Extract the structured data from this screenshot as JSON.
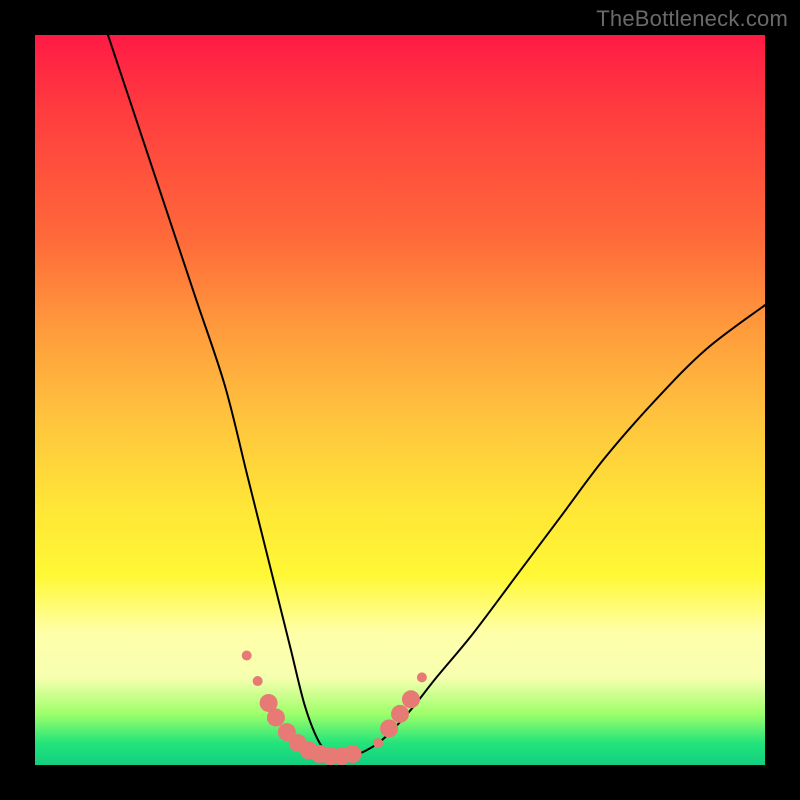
{
  "watermark": "TheBottleneck.com",
  "chart_data": {
    "type": "line",
    "title": "",
    "xlabel": "",
    "ylabel": "",
    "xlim": [
      0,
      100
    ],
    "ylim": [
      0,
      100
    ],
    "grid": false,
    "legend": false,
    "series": [
      {
        "name": "bottleneck-curve",
        "color": "#000000",
        "x": [
          10,
          14,
          18,
          22,
          26,
          29,
          31,
          33,
          35,
          37,
          39,
          41,
          43,
          47,
          51,
          55,
          60,
          66,
          72,
          78,
          85,
          92,
          100
        ],
        "y": [
          100,
          88,
          76,
          64,
          52,
          40,
          32,
          24,
          16,
          8,
          3,
          1,
          1,
          3,
          7,
          12,
          18,
          26,
          34,
          42,
          50,
          57,
          63
        ]
      }
    ],
    "markers": {
      "name": "highlight-dots",
      "color": "#e77a74",
      "radius_small": 5,
      "radius_large": 9,
      "points": [
        {
          "x": 29.0,
          "y": 15.0,
          "r": "small"
        },
        {
          "x": 30.5,
          "y": 11.5,
          "r": "small"
        },
        {
          "x": 32.0,
          "y": 8.5,
          "r": "large"
        },
        {
          "x": 33.0,
          "y": 6.5,
          "r": "large"
        },
        {
          "x": 34.5,
          "y": 4.5,
          "r": "large"
        },
        {
          "x": 36.0,
          "y": 3.0,
          "r": "large"
        },
        {
          "x": 37.5,
          "y": 2.0,
          "r": "large"
        },
        {
          "x": 39.0,
          "y": 1.5,
          "r": "large"
        },
        {
          "x": 40.5,
          "y": 1.2,
          "r": "large"
        },
        {
          "x": 42.0,
          "y": 1.2,
          "r": "large"
        },
        {
          "x": 43.5,
          "y": 1.5,
          "r": "large"
        },
        {
          "x": 47.0,
          "y": 3.0,
          "r": "small"
        },
        {
          "x": 48.5,
          "y": 5.0,
          "r": "large"
        },
        {
          "x": 50.0,
          "y": 7.0,
          "r": "large"
        },
        {
          "x": 51.5,
          "y": 9.0,
          "r": "large"
        },
        {
          "x": 53.0,
          "y": 12.0,
          "r": "small"
        }
      ]
    },
    "background_gradient": {
      "top": "#ff1a45",
      "mid": "#ffe437",
      "bottom": "#13cf80"
    }
  }
}
